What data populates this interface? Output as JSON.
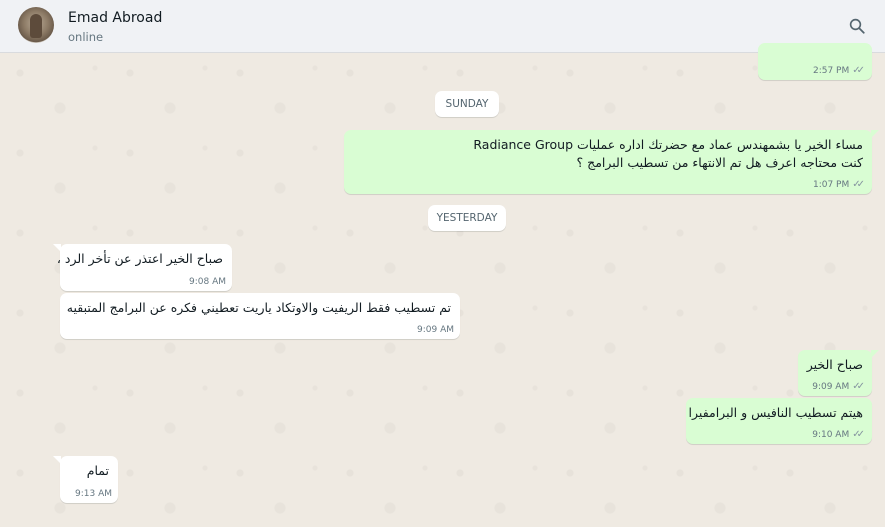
{
  "header": {
    "contact_name": "Emad Abroad",
    "status": "online",
    "search_icon": "search-icon"
  },
  "messages": [
    {
      "type": "out",
      "text_lines": [
        ""
      ],
      "time": "2:57 PM",
      "ticks": "double-check"
    },
    {
      "type": "divider",
      "label": "SUNDAY"
    },
    {
      "type": "out",
      "text_lines": [
        "مساء الخير يا بشمهندس عماد مع حضرتك اداره عمليات Radiance Group",
        "كنت محتاجه اعرف هل تم الانتهاء من تسطيب البرامج ؟"
      ],
      "time": "1:07 PM",
      "ticks": "double-check"
    },
    {
      "type": "divider",
      "label": "YESTERDAY"
    },
    {
      "type": "in",
      "text_lines": [
        "صباح الخير اعتذر عن تأخر الرد ،"
      ],
      "time": "9:08 AM"
    },
    {
      "type": "in",
      "text_lines": [
        "تم تسطيب فقط الريفيت والاوتكاد ياريت تعطيني فكره عن البرامج المتبقيه"
      ],
      "time": "9:09 AM"
    },
    {
      "type": "out",
      "text_lines": [
        "صباح الخير"
      ],
      "time": "9:09 AM",
      "ticks": "double-check"
    },
    {
      "type": "out",
      "text_lines": [
        "هيتم تسطيب النافيس و البرامفيرا"
      ],
      "time": "9:10 AM",
      "ticks": "double-check"
    },
    {
      "type": "in",
      "text_lines": [
        "تمام"
      ],
      "time": "9:13 AM"
    }
  ],
  "colors": {
    "outgoing_bubble": "#d9fdd3",
    "incoming_bubble": "#ffffff",
    "chat_background": "#efeae2",
    "header_background": "#f0f2f5"
  }
}
